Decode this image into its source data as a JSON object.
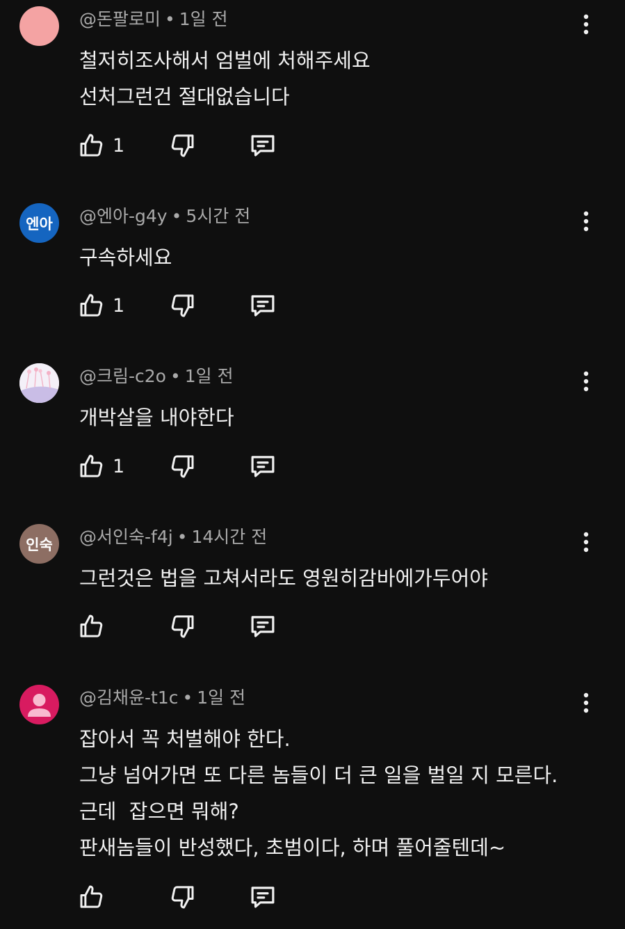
{
  "comments": [
    {
      "author": "@돈팔로미",
      "time": "1일 전",
      "avatar": {
        "type": "solid",
        "color": "#f4a3a3",
        "text": ""
      },
      "lines": [
        "철저히조사해서 엄벌에 처해주세요",
        "선처그런건 절대없습니다"
      ],
      "likes": "1"
    },
    {
      "author": "@엔아-g4y",
      "time": "5시간 전",
      "avatar": {
        "type": "text",
        "color": "#1565c0",
        "text": "엔아"
      },
      "lines": [
        "구속하세요"
      ],
      "likes": "1"
    },
    {
      "author": "@크림-c2o",
      "time": "1일 전",
      "avatar": {
        "type": "image",
        "color": "#e9e3f2",
        "text": ""
      },
      "lines": [
        "개박살을 내야한다"
      ],
      "likes": "1"
    },
    {
      "author": "@서인숙-f4j",
      "time": "14시간 전",
      "avatar": {
        "type": "text",
        "color": "#8d6e63",
        "text": "인숙"
      },
      "lines": [
        "그런것은 법을 고쳐서라도 영원히감바에가두어야"
      ],
      "likes": ""
    },
    {
      "author": "@김채윤-t1c",
      "time": "1일 전",
      "avatar": {
        "type": "person",
        "color": "#d81b60",
        "text": ""
      },
      "lines": [
        "잡아서 꼭 처벌해야 한다.",
        "그냥 넘어가면 또 다른 놈들이 더 큰 일을 벌일 지 모른다.",
        "근데  잡으면 뭐해?",
        "판새놈들이 반성했다, 초범이다, 하며 풀어줄텐데~"
      ],
      "likes": ""
    }
  ],
  "icons": {
    "like": "thumbs-up-icon",
    "dislike": "thumbs-down-icon",
    "reply": "reply-icon",
    "menu": "more-vertical-icon"
  },
  "colors": {
    "background": "#0f0f0f",
    "text": "#f1f1f1",
    "meta": "#aaaaaa"
  }
}
